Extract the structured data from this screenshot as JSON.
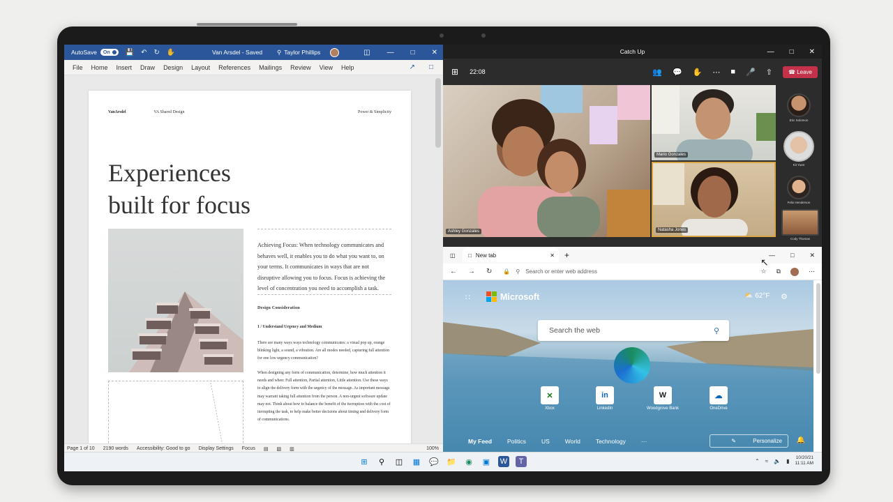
{
  "word": {
    "autosave": "AutoSave",
    "autosave_state": "On",
    "doc_title": "Van Arsdel - Saved",
    "user": "Taylor Phillips",
    "menu": [
      "File",
      "Home",
      "Insert",
      "Draw",
      "Design",
      "Layout",
      "References",
      "Mailings",
      "Review",
      "View",
      "Help"
    ],
    "page": {
      "brand": "VanArsdel",
      "section": "VA Shared Design",
      "tagline": "Power & Simplicity",
      "headline_1": "Experiences",
      "headline_2": "built for focus",
      "lede": "Achieving Focus: When technology communicates and behaves well, it enables you to do what you want to, on your terms. It communicates in ways that are not disruptive allowing you to focus. Focus is achieving the level of concentration you need to accomplish a task.",
      "design_heading": "Design Consideration",
      "sub_heading": "1 / Understand Urgency and Medium",
      "para_1": "There are many ways ways technology communicates: a visual pop up, orange blinking light, a sound, a vibration. Are all modes needed, capturing full attention for one low urgency communication?",
      "para_2": "When designing any form of communication, determine, how much attention it needs and when: Full attention, Partial attention, Little attention. Use these ways to align the delivery form with the urgency of the message. As important message may warrant taking full attention from the person. A non-urgent software update may not. Think about how to balance the benefit of the iterruption with the cost of iterrupting the task, to help make better decisions about timing and delivery form of communications."
    },
    "status": {
      "pages": "Page 1 of 10",
      "words": "2190 words",
      "accessibility": "Accessibility: Good to go",
      "display": "Display Settings",
      "focus": "Focus",
      "zoom": "100%"
    }
  },
  "teams": {
    "title": "Catch Up",
    "time": "22:08",
    "leave": "Leave",
    "participants": {
      "ashley": "Ashley Gonzales",
      "mario": "Mario Gonzales",
      "natasha": "Natasha Jones"
    },
    "roster": [
      "Eric Solomon",
      "Kit Yuen",
      "Felix Henderson",
      "Cody Thomas"
    ]
  },
  "edge": {
    "tab": "New tab",
    "address_placeholder": "Search or enter web address",
    "brand": "Microsoft",
    "weather": "62°F",
    "search_placeholder": "Search the web",
    "tiles": [
      "Xbox",
      "LinkedIn",
      "Woodgrove Bank",
      "OneDrive"
    ],
    "nav": [
      "My Feed",
      "Politics",
      "US",
      "World",
      "Technology",
      "···"
    ],
    "personalize": "Personalize"
  },
  "taskbar": {
    "date": "10/20/21",
    "time": "11:11 AM"
  },
  "colors": {
    "word_blue": "#2b579a",
    "teams_leave": "#c4314b",
    "edge_link": "#2b6fb0"
  }
}
